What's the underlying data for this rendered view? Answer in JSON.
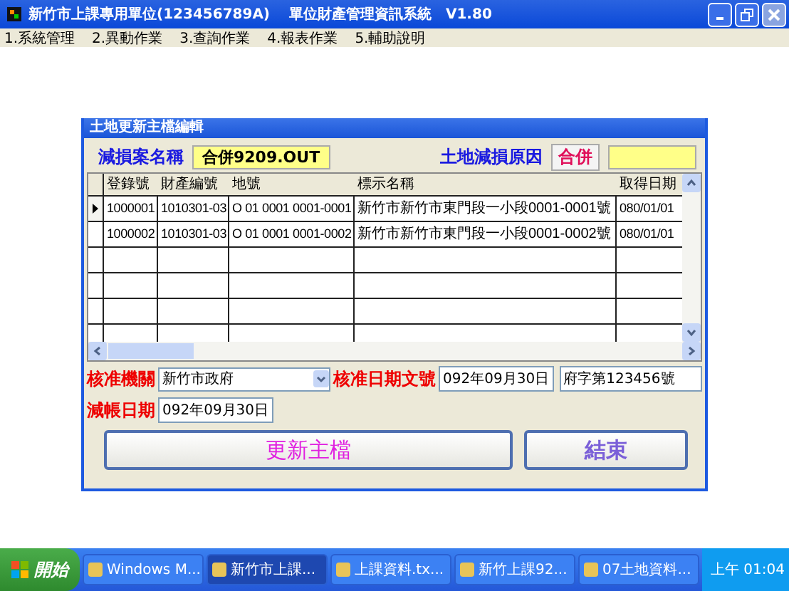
{
  "window": {
    "title": "新竹市上課專用單位(123456789A)　 單位財產管理資訊系統　V1.80"
  },
  "menu": [
    {
      "label": "1.系統管理"
    },
    {
      "label": "2.異動作業"
    },
    {
      "label": "3.查詢作業"
    },
    {
      "label": "4.報表作業"
    },
    {
      "label": "5.輔助說明"
    }
  ],
  "dialog": {
    "title": "土地更新主檔編輯",
    "case_name_label": "減損案名稱",
    "case_name": "合併9209.OUT",
    "reason_label": "土地減損原因",
    "reason": "合併",
    "table": {
      "columns": [
        "登錄號",
        "財產編號",
        "地號",
        "標示名稱",
        "取得日期"
      ],
      "rows": [
        {
          "selected": true,
          "cells": [
            "1000001",
            "1010301-03",
            "O 01 0001 0001-0001",
            "新竹市新竹市東門段一小段0001-0001號",
            "080/01/01"
          ]
        },
        {
          "selected": false,
          "cells": [
            "1000002",
            "1010301-03",
            "O 01 0001 0001-0002",
            "新竹市新竹市東門段一小段0001-0002號",
            "080/01/01"
          ]
        }
      ]
    },
    "agency_label": "核准機關",
    "agency": "新竹市政府",
    "approval_label": "核准日期文號",
    "approval_date": "092年09月30日",
    "approval_no": "府字第123456號",
    "writeoff_label": "減帳日期",
    "writeoff_date": "092年09月30日",
    "buttons": [
      {
        "kind": "update",
        "label": "更新主檔"
      },
      {
        "kind": "exit",
        "label": "結束"
      }
    ]
  },
  "taskbar": {
    "start": "開始",
    "tasks": [
      {
        "label": "Windows M...",
        "selected": false
      },
      {
        "label": "新竹市上課...",
        "selected": true
      },
      {
        "label": "上課資料.tx...",
        "selected": false
      },
      {
        "label": "新竹上課92...",
        "selected": false
      },
      {
        "label": "07土地資料...",
        "selected": false
      }
    ],
    "clock": "上午 01:04"
  }
}
